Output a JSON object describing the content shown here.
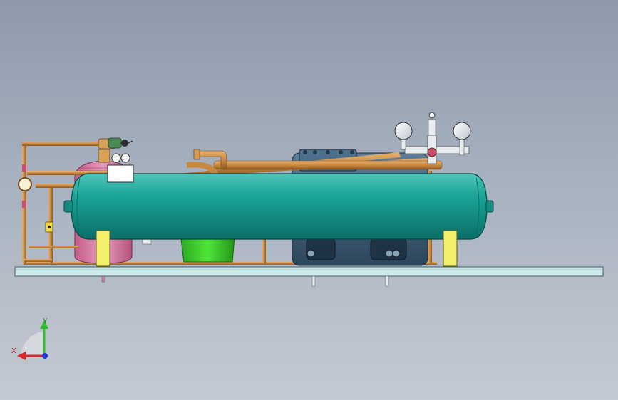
{
  "viewport": {
    "background_top": "#8e9aab",
    "background_bottom": "#c4cad3"
  },
  "model": {
    "receiver_tank_color": "#17968c",
    "copper_pipe_color": "#c9883f",
    "support_saddle_color": "#f2ef6a",
    "filter_drier_color": "#d87fa6",
    "separator_color": "#3ecb2c",
    "compressor_color": "#3f5e78",
    "base_frame_color": "#cde9ea"
  },
  "triad": {
    "y_label": "Y",
    "x_label": "X",
    "y_color": "#2fbf2f",
    "x_color": "#d9252c",
    "z_color": "#1f3bd6"
  }
}
